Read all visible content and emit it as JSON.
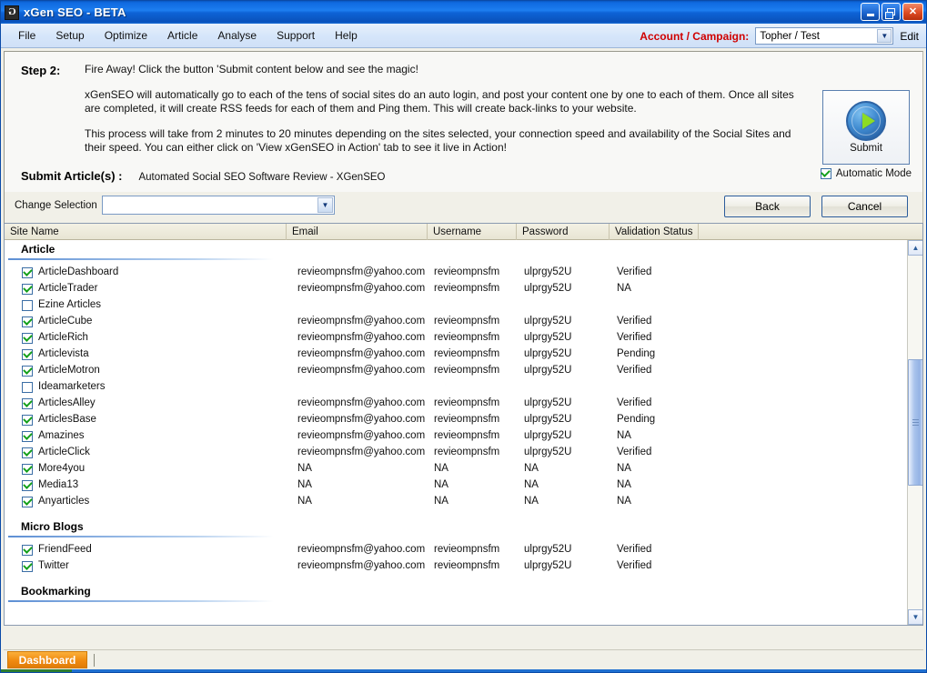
{
  "window": {
    "title": "xGen SEO - BETA",
    "icon": "app-logo-icon",
    "minimize": "minimize-icon",
    "restore": "restore-icon",
    "close": "close-icon"
  },
  "menu": {
    "items": [
      "File",
      "Setup",
      "Optimize",
      "Article",
      "Analyse",
      "Support",
      "Help"
    ],
    "account_label": "Account / Campaign:",
    "account_value": "Topher / Test",
    "account_color": "#d00000",
    "edit_label": "Edit"
  },
  "step": {
    "label": "Step 2:",
    "line1": "Fire Away! Click the button 'Submit content below and see the magic!",
    "line2": "xGenSEO will automatically go to each of the tens of social sites do an auto login, and post  your content one by one to each of them. Once all sites are completed, it will create RSS feeds for each of them and Ping them. This will create back-links to your website.",
    "line3": "This process will take from 2 minutes to 20 minutes depending on the sites selected, your connection speed and availability of the Social Sites and their speed. You can either click on 'View xGenSEO in Action' tab to see it live in Action!",
    "submit_articles_label": "Submit Article(s) :",
    "submit_articles_value": "Automated Social SEO Software Review - XGenSEO"
  },
  "submit_panel": {
    "button_caption": "Submit",
    "icon": "submit-play-icon",
    "automatic_mode_label": "Automatic Mode",
    "automatic_mode_checked": true
  },
  "toolbar": {
    "change_selection_label": "Change Selection",
    "change_selection_value": "",
    "back_label": "Back",
    "cancel_label": "Cancel"
  },
  "grid": {
    "columns": [
      "Site Name",
      "Email",
      "Username",
      "Password",
      "Validation Status"
    ],
    "groups": [
      {
        "name": "Article",
        "rows": [
          {
            "checked": true,
            "site": "ArticleDashboard",
            "email": "revieompnsfm@yahoo.com",
            "username": "revieompnsfm",
            "password": "ulprgy52U",
            "status": "Verified"
          },
          {
            "checked": true,
            "site": "ArticleTrader",
            "email": "revieompnsfm@yahoo.com",
            "username": "revieompnsfm",
            "password": "ulprgy52U",
            "status": "NA"
          },
          {
            "checked": false,
            "site": "Ezine Articles",
            "email": "",
            "username": "",
            "password": "",
            "status": ""
          },
          {
            "checked": true,
            "site": "ArticleCube",
            "email": "revieompnsfm@yahoo.com",
            "username": "revieompnsfm",
            "password": "ulprgy52U",
            "status": "Verified"
          },
          {
            "checked": true,
            "site": "ArticleRich",
            "email": "revieompnsfm@yahoo.com",
            "username": "revieompnsfm",
            "password": "ulprgy52U",
            "status": "Verified"
          },
          {
            "checked": true,
            "site": "Articlevista",
            "email": "revieompnsfm@yahoo.com",
            "username": "revieompnsfm",
            "password": "ulprgy52U",
            "status": "Pending"
          },
          {
            "checked": true,
            "site": "ArticleMotron",
            "email": "revieompnsfm@yahoo.com",
            "username": "revieompnsfm",
            "password": "ulprgy52U",
            "status": "Verified"
          },
          {
            "checked": false,
            "site": "Ideamarketers",
            "email": "",
            "username": "",
            "password": "",
            "status": ""
          },
          {
            "checked": true,
            "site": "ArticlesAlley",
            "email": "revieompnsfm@yahoo.com",
            "username": "revieompnsfm",
            "password": "ulprgy52U",
            "status": "Verified"
          },
          {
            "checked": true,
            "site": "ArticlesBase",
            "email": "revieompnsfm@yahoo.com",
            "username": "revieompnsfm",
            "password": "ulprgy52U",
            "status": "Pending"
          },
          {
            "checked": true,
            "site": "Amazines",
            "email": "revieompnsfm@yahoo.com",
            "username": "revieompnsfm",
            "password": "ulprgy52U",
            "status": "NA"
          },
          {
            "checked": true,
            "site": "ArticleClick",
            "email": "revieompnsfm@yahoo.com",
            "username": "revieompnsfm",
            "password": "ulprgy52U",
            "status": "Verified"
          },
          {
            "checked": true,
            "site": "More4you",
            "email": "NA",
            "username": "NA",
            "password": "NA",
            "status": "NA"
          },
          {
            "checked": true,
            "site": "Media13",
            "email": "NA",
            "username": "NA",
            "password": "NA",
            "status": "NA"
          },
          {
            "checked": true,
            "site": "Anyarticles",
            "email": "NA",
            "username": "NA",
            "password": "NA",
            "status": "NA"
          }
        ]
      },
      {
        "name": "Micro Blogs",
        "rows": [
          {
            "checked": true,
            "site": "FriendFeed",
            "email": "revieompnsfm@yahoo.com",
            "username": "revieompnsfm",
            "password": "ulprgy52U",
            "status": "Verified"
          },
          {
            "checked": true,
            "site": "Twitter",
            "email": "revieompnsfm@yahoo.com",
            "username": "revieompnsfm",
            "password": "ulprgy52U",
            "status": "Verified"
          }
        ]
      },
      {
        "name": "Bookmarking",
        "rows": []
      }
    ],
    "scrollbar": {
      "up_icon": "chevron-up-icon",
      "down_icon": "chevron-down-icon"
    }
  },
  "statusbar": {
    "dashboard_tab": "Dashboard"
  }
}
